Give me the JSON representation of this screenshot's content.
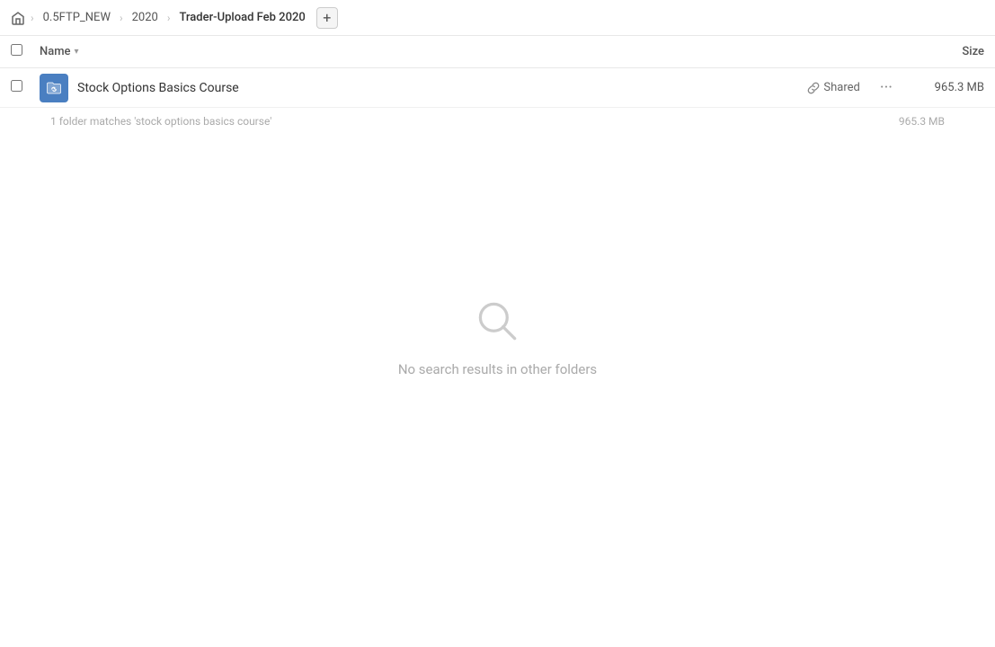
{
  "breadcrumb": {
    "home_icon": "home",
    "items": [
      {
        "label": "0.5FTP_NEW",
        "active": false
      },
      {
        "label": "2020",
        "active": false
      },
      {
        "label": "Trader-Upload Feb 2020",
        "active": true
      }
    ],
    "add_button_label": "+"
  },
  "columns": {
    "name_label": "Name",
    "sort_icon": "▾",
    "size_label": "Size"
  },
  "file_row": {
    "icon_type": "folder-link",
    "name": "Stock Options Basics Course",
    "shared_label": "Shared",
    "more_label": "···",
    "size": "965.3 MB"
  },
  "summary": {
    "text": "1 folder matches 'stock options basics course'",
    "size": "965.3 MB"
  },
  "empty_state": {
    "message": "No search results in other folders"
  }
}
